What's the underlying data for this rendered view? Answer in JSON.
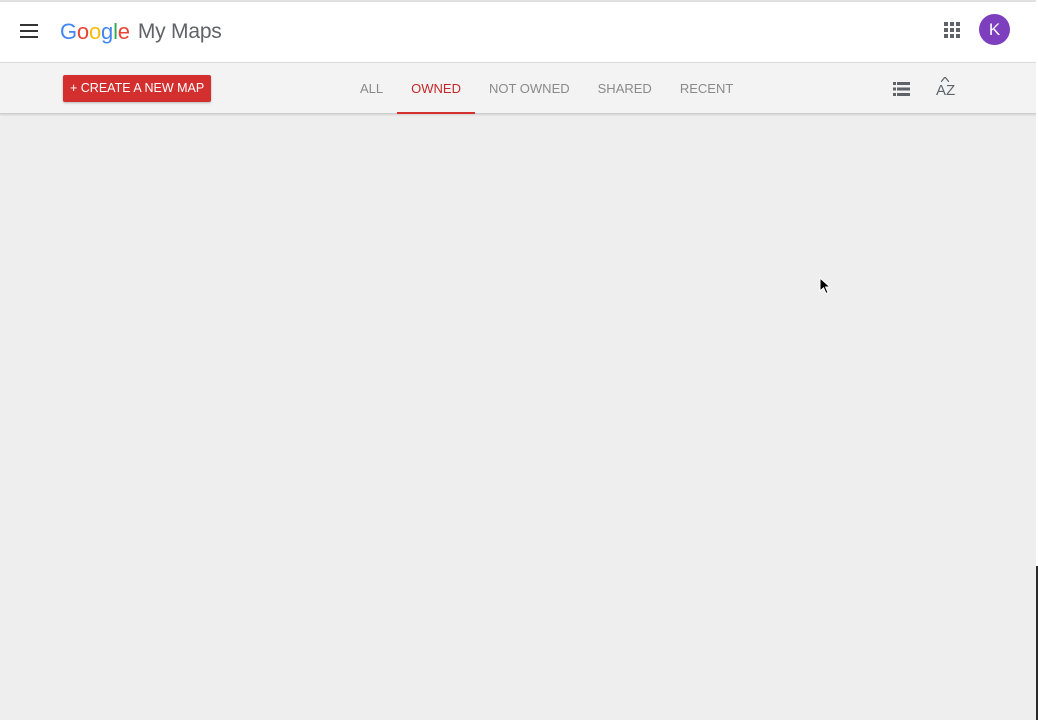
{
  "header": {
    "logo_letters": [
      {
        "ch": "G",
        "cls": "g-blue"
      },
      {
        "ch": "o",
        "cls": "g-red"
      },
      {
        "ch": "o",
        "cls": "g-yellow"
      },
      {
        "ch": "g",
        "cls": "g-blue"
      },
      {
        "ch": "l",
        "cls": "g-green"
      },
      {
        "ch": "e",
        "cls": "g-red"
      }
    ],
    "product_name": "My Maps",
    "menu_icon": "hamburger-menu-icon",
    "apps_icon": "apps-grid-icon",
    "avatar_initial": "K",
    "avatar_color": "#7e3fbf"
  },
  "toolbar": {
    "create_label": "+ CREATE A NEW MAP",
    "accent_color": "#d32f2f",
    "tabs": [
      {
        "label": "ALL",
        "active": false
      },
      {
        "label": "OWNED",
        "active": true
      },
      {
        "label": "NOT OWNED",
        "active": false
      },
      {
        "label": "SHARED",
        "active": false
      },
      {
        "label": "RECENT",
        "active": false
      }
    ],
    "list_view_icon": "list-view-icon",
    "sort_icon": "sort-az-icon",
    "sort_label": "AZ"
  }
}
